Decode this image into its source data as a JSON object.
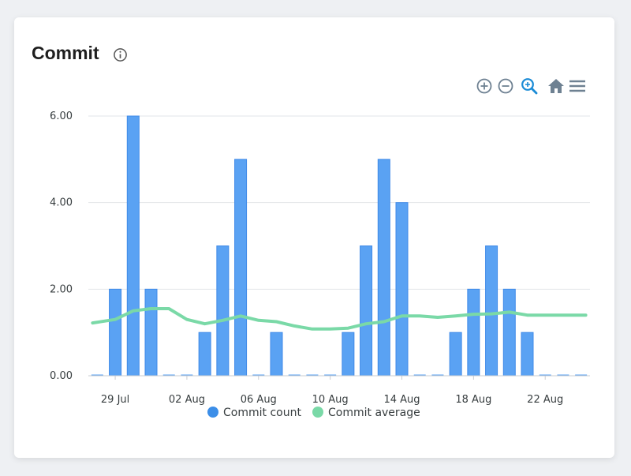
{
  "card": {
    "title": "Commit"
  },
  "toolbar": {
    "zoom_in": "zoom-in-icon",
    "zoom_out": "zoom-out-icon",
    "selection_zoom": "selection-zoom-icon",
    "reset": "home-icon",
    "menu": "menu-icon"
  },
  "colors": {
    "bar": "#5aa2f3",
    "bar_stroke": "#3f8ae8",
    "line": "#7ad9a7",
    "toolbar_icon": "#6e8192",
    "toolbar_active": "#1a8bd6"
  },
  "chart_data": {
    "type": "bar",
    "x": [
      "28 Jul",
      "29 Jul",
      "30 Jul",
      "31 Jul",
      "01 Aug",
      "02 Aug",
      "03 Aug",
      "04 Aug",
      "05 Aug",
      "06 Aug",
      "07 Aug",
      "08 Aug",
      "09 Aug",
      "10 Aug",
      "11 Aug",
      "12 Aug",
      "13 Aug",
      "14 Aug",
      "15 Aug",
      "16 Aug",
      "17 Aug",
      "18 Aug",
      "19 Aug",
      "20 Aug",
      "21 Aug",
      "22 Aug",
      "23 Aug",
      "24 Aug"
    ],
    "x_tick_labels": [
      "29 Jul",
      "02 Aug",
      "06 Aug",
      "10 Aug",
      "14 Aug",
      "18 Aug",
      "22 Aug"
    ],
    "series": [
      {
        "name": "Commit count",
        "type": "bar",
        "values": [
          0,
          2,
          6,
          2,
          0,
          0,
          1,
          3,
          5,
          0,
          1,
          0,
          0,
          0,
          1,
          3,
          5,
          4,
          0,
          0,
          1,
          2,
          3,
          2,
          1,
          0,
          0,
          0
        ]
      },
      {
        "name": "Commit average",
        "type": "line",
        "values": [
          1.22,
          1.3,
          1.5,
          1.55,
          1.55,
          1.3,
          1.2,
          1.28,
          1.38,
          1.28,
          1.25,
          1.15,
          1.08,
          1.08,
          1.1,
          1.2,
          1.25,
          1.38,
          1.38,
          1.35,
          1.38,
          1.42,
          1.43,
          1.47,
          1.4,
          1.4,
          1.4,
          1.4
        ]
      }
    ],
    "y_ticks": [
      "0.00",
      "2.00",
      "4.00",
      "6.00"
    ],
    "ylim": [
      0,
      6
    ],
    "grid": true,
    "legend": "bottom-center"
  }
}
